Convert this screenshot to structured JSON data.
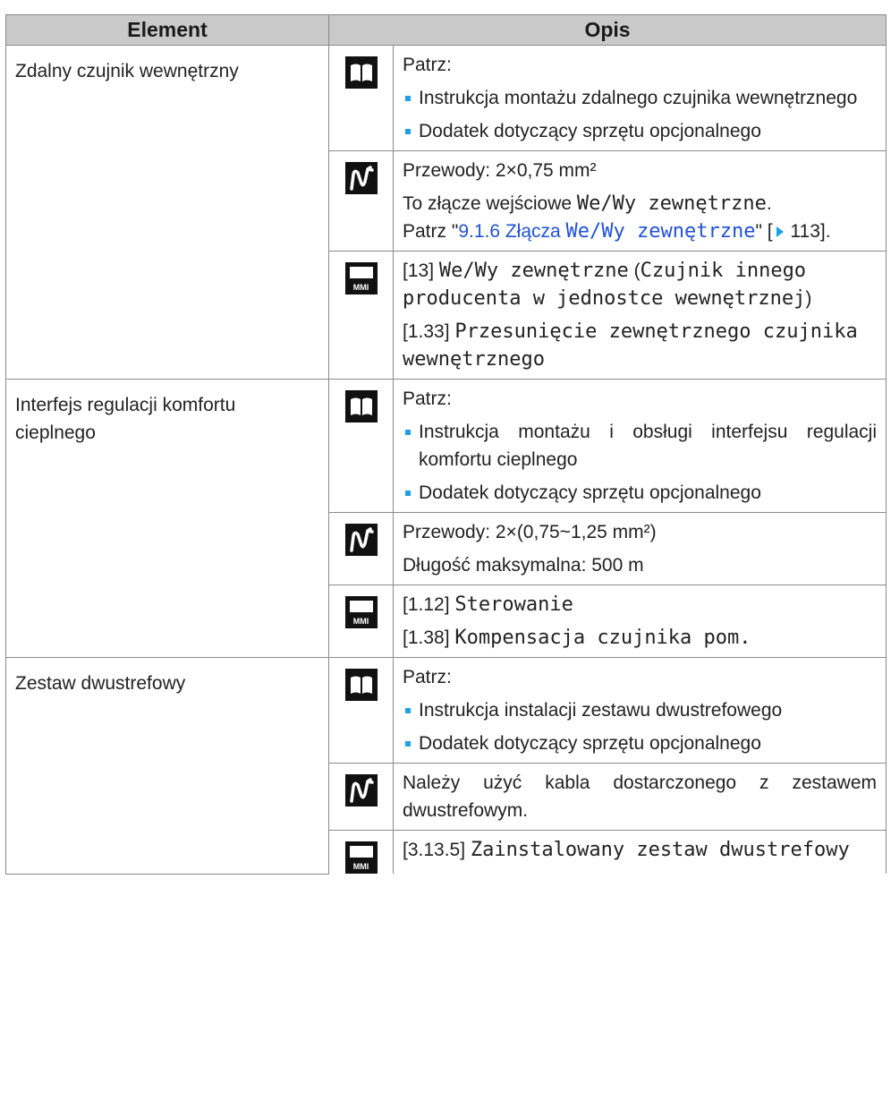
{
  "header": {
    "col_element": "Element",
    "col_opis": "Opis"
  },
  "icons": {
    "book": "book-icon",
    "wiring": "wiring-icon",
    "mmi": "mmi-icon",
    "mmi_label": "MMI"
  },
  "rows": [
    {
      "element": "Zdalny czujnik wewnętrzny",
      "see_label": "Patrz:",
      "bullets": [
        "Instrukcja montażu zdalnego czujnika wewnętrznego",
        "Dodatek dotyczący sprzętu opcjonalnego"
      ],
      "wiring_line1": "Przewody: 2×0,75 mm²",
      "wiring_line2_prefix": "To złącze wejściowe ",
      "wiring_line2_mono": "We/Wy zewnętrzne",
      "wiring_line2_suffix": ".",
      "wiring_ref_prefix": "Patrz \"",
      "wiring_ref_link": "9.1.6 Złącza ",
      "wiring_ref_link_mono": "We/Wy zewnętrzne",
      "wiring_ref_close": "\" [",
      "wiring_ref_page": " 113",
      "wiring_ref_end": "].",
      "mmi1_code": "[13] ",
      "mmi1_mono": "We/Wy zewnętrzne",
      "mmi1_paren_open": " (",
      "mmi1_paren_mono": "Czujnik innego producenta w jednostce wewnętrznej",
      "mmi1_paren_close": ")",
      "mmi2_code": "[1.33] ",
      "mmi2_mono": "Przesunięcie zewnętrznego czujnika wewnętrznego"
    },
    {
      "element": "Interfejs regulacji komfortu cieplnego",
      "see_label": "Patrz:",
      "bullets": [
        "Instrukcja montażu i obsługi interfejsu regulacji komfortu cieplnego",
        "Dodatek dotyczący sprzętu opcjonalnego"
      ],
      "wiring_line1": "Przewody: 2×(0,75~1,25 mm²)",
      "wiring_line2": "Długość maksymalna: 500 m",
      "mmi1_code": "[1.12] ",
      "mmi1_mono": "Sterowanie",
      "mmi2_code": "[1.38] ",
      "mmi2_mono": "Kompensacja czujnika pom."
    },
    {
      "element": "Zestaw dwustrefowy",
      "see_label": "Patrz:",
      "bullets": [
        "Instrukcja instalacji zestawu dwustrefowego",
        "Dodatek dotyczący sprzętu opcjonalnego"
      ],
      "wiring_line1": "Należy użyć kabla dostarczonego z zestawem dwustrefowym.",
      "mmi1_code": "[3.13.5] ",
      "mmi1_mono": "Zainstalowany zestaw dwustrefowy"
    }
  ]
}
